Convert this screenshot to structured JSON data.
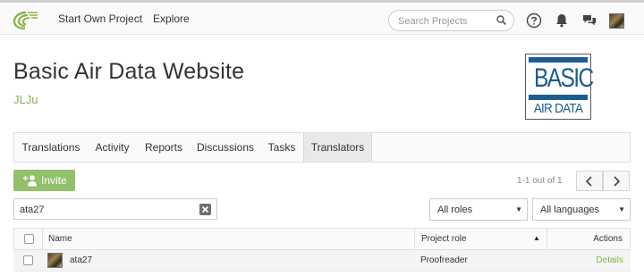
{
  "nav": {
    "links": [
      "Start Own Project",
      "Explore"
    ],
    "search_placeholder": "Search Projects"
  },
  "project": {
    "title": "Basic Air Data Website",
    "owner": "JLJu",
    "logo_text_top": "BASIC",
    "logo_text_bottom": "AIR DATA"
  },
  "tabs": [
    "Translations",
    "Activity",
    "Reports",
    "Discussions",
    "Tasks",
    "Translators"
  ],
  "active_tab": "Translators",
  "toolbar": {
    "invite_label": "Invite",
    "pagination": "1-1 out of 1"
  },
  "filters": {
    "search_value": "ata27",
    "roles": "All roles",
    "languages": "All languages"
  },
  "table": {
    "headers": {
      "name": "Name",
      "role": "Project role",
      "actions": "Actions"
    },
    "rows": [
      {
        "name": "ata27",
        "role": "Proofreader",
        "action": "Details"
      }
    ]
  },
  "colors": {
    "accent_green": "#93c06b",
    "link_green": "#8ab548",
    "logo_blue": "#1b5d8f"
  }
}
